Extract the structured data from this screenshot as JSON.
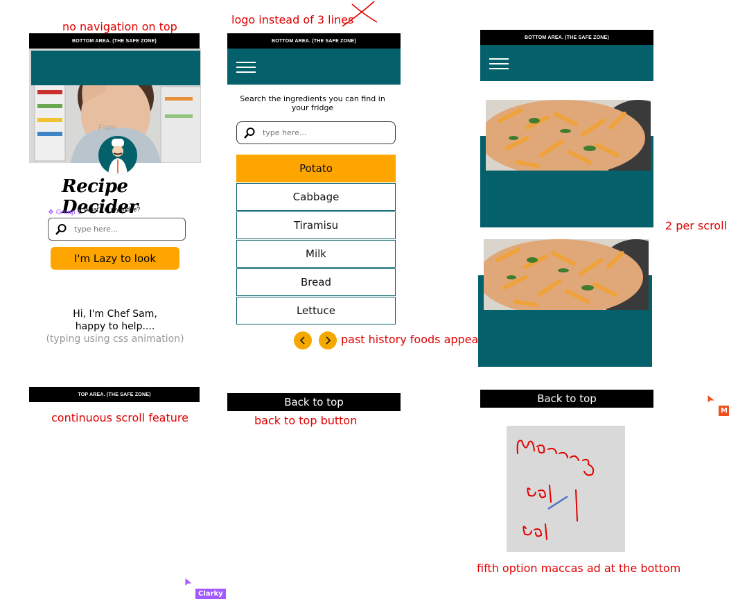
{
  "notes": {
    "no_nav": "no navigation on top",
    "logo_instead": "logo instead of 3 lines",
    "per_scroll": "2 per scroll",
    "continuous": "continuous scroll feature",
    "back_to_top_note": "back to top button",
    "past_history": "past history foods appear",
    "fifth_option": "fifth option maccas ad at the bottom"
  },
  "screen1": {
    "top_bar": "BOTTOM AREA. (THE SAFE ZONE)",
    "bottom_bar": "TOP  AREA. (THE SAFE ZONE)",
    "faint_label": "Fram",
    "logo_title": "Recipe Decider",
    "logo_subtitle": "What's in my fridge?",
    "group_label": "❖ Group 1",
    "search_placeholder": "type here...",
    "lazy_button": "I'm Lazy to look",
    "chef_line1": "Hi, I'm Chef Sam,",
    "chef_line2": "happy to help....",
    "chef_line3": "(typing using css animation)"
  },
  "screen2": {
    "top_bar": "BOTTOM AREA. (THE SAFE ZONE)",
    "instruction": "Search the ingredients you can find in your fridge",
    "search_placeholder": "type here...",
    "ingredients": [
      {
        "label": "Potato",
        "selected": true
      },
      {
        "label": "Cabbage",
        "selected": false
      },
      {
        "label": "Tiramisu",
        "selected": false
      },
      {
        "label": "Milk",
        "selected": false
      },
      {
        "label": "Bread",
        "selected": false
      },
      {
        "label": "Lettuce",
        "selected": false
      }
    ],
    "back_to_top": "Back to top"
  },
  "screen3": {
    "top_bar": "BOTTOM AREA. (THE SAFE ZONE)",
    "back_to_top": "Back to top",
    "ad_note": "maccas ad sketch"
  },
  "cursors": [
    {
      "name": "Clarky",
      "color": "#a259ff"
    },
    {
      "name": "M",
      "color": "#f24e1e"
    }
  ],
  "colors": {
    "teal": "#04606b",
    "orange": "#ffa500",
    "annotation": "#e00000"
  }
}
